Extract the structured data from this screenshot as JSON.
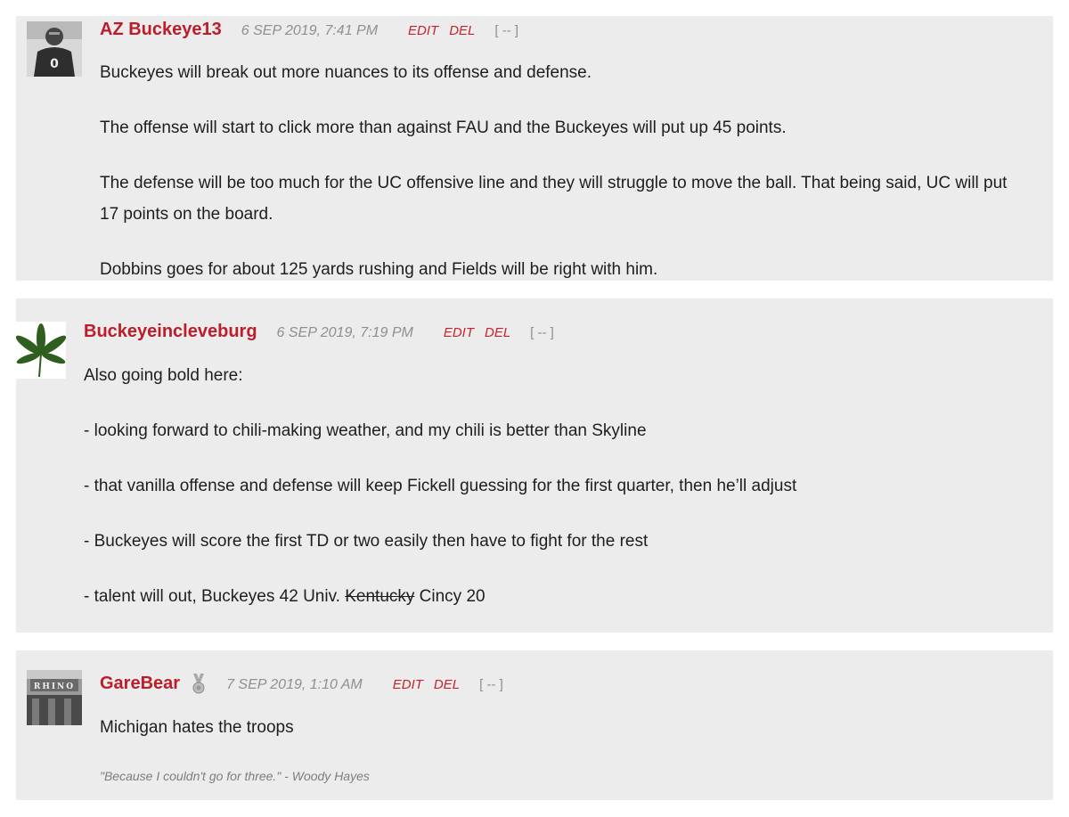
{
  "comments": [
    {
      "username": "AZ Buckeye13",
      "timestamp": "6 SEP 2019, 7:41 PM",
      "edit_label": "EDIT",
      "del_label": "DEL",
      "collapse_label": "[ -- ]",
      "paragraphs": [
        "Buckeyes will break out more nuances to its offense and defense.",
        "The offense will start to click more than against FAU and the Buckeyes will put up 45 points.",
        "The defense will be too much for the UC offensive line and they will struggle to move the ball. That being said, UC will put 17 points on the board.",
        "Dobbins goes for about 125 yards rushing and Fields will be right with him."
      ]
    },
    {
      "username": "Buckeyeincleveburg",
      "timestamp": "6 SEP 2019, 7:19 PM",
      "edit_label": "EDIT",
      "del_label": "DEL",
      "collapse_label": "[ -- ]",
      "paragraphs": [
        "Also going bold here:",
        "- looking forward to chili-making weather, and my chili is better than Skyline",
        "- that vanilla offense and defense will keep Fickell guessing for the first quarter, then he’ll adjust",
        "- Buckeyes will score the first TD or two easily then have to fight for the rest"
      ],
      "last_line": {
        "before": "- talent will out, Buckeyes 42 Univ. ",
        "struck": "Kentucky",
        "after": " Cincy 20"
      }
    },
    {
      "username": "GareBear",
      "timestamp": "7 SEP 2019, 1:10 AM",
      "edit_label": "EDIT",
      "del_label": "DEL",
      "collapse_label": "[ -- ]",
      "avatar_sign_text": "RHINO",
      "paragraphs": [
        "Michigan hates the troops"
      ],
      "signature": "\"Because I couldn't go for three.\" - Woody Hayes"
    }
  ],
  "colors": {
    "username": "#bb1e2a",
    "action": "#c8232c",
    "card_bg": "#ececec",
    "meta": "#8f8f8f"
  }
}
